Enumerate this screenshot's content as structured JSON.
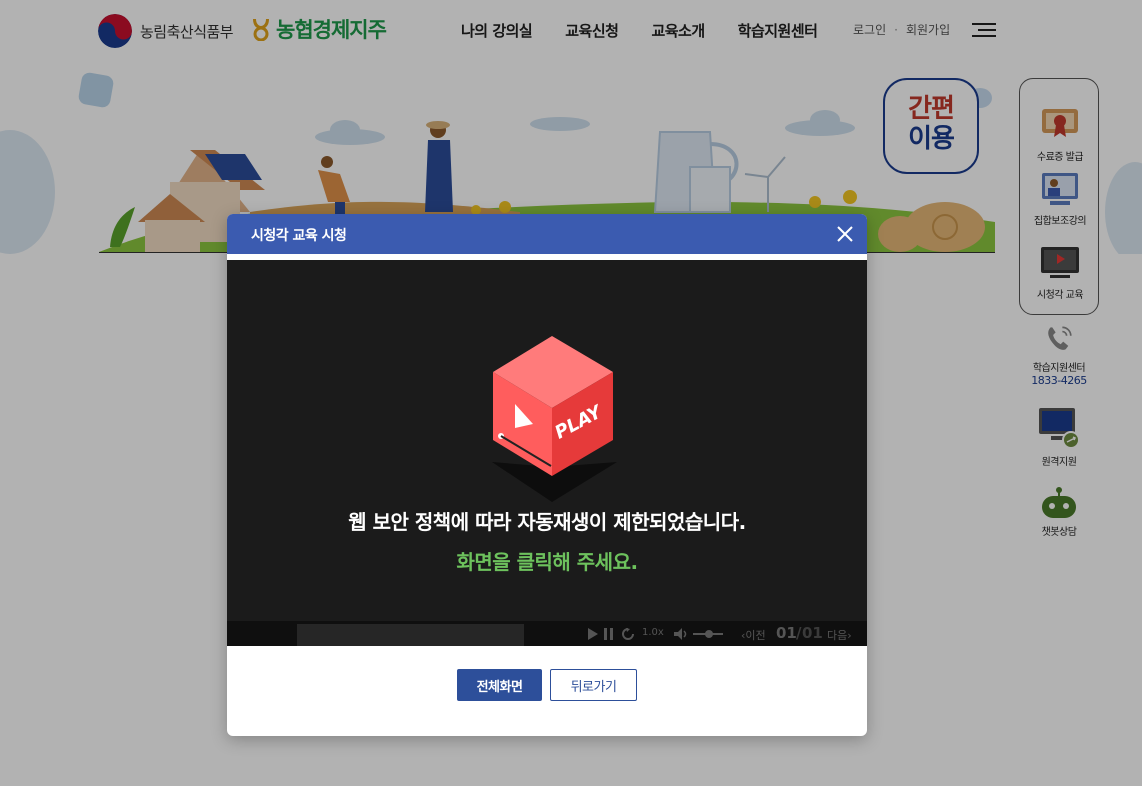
{
  "header": {
    "gov_logo_text": "농림축산식품부",
    "nh_logo_text": "농협경제지주",
    "nav": [
      "나의 강의실",
      "교육신청",
      "교육소개",
      "학습지원센터"
    ],
    "login": "로그인",
    "signup": "회원가입",
    "util_separator": "·"
  },
  "badge": {
    "line1": "간편",
    "line2": "이용"
  },
  "quick_menu": {
    "items": [
      {
        "label": "수료증 발급",
        "icon": "certificate-icon"
      },
      {
        "label": "집합보조강의",
        "icon": "video-lecture-icon"
      },
      {
        "label": "시청각 교육",
        "icon": "audiovisual-icon"
      }
    ],
    "support": {
      "label": "학습지원센터",
      "phone": "1833-4265"
    },
    "remote": {
      "label": "원격지원"
    },
    "chatbot": {
      "label": "챗봇상담"
    }
  },
  "modal": {
    "title": "시청각 교육 시청",
    "notice_line1": "웹 보안 정책에 따라 자동재생이 제한되었습니다.",
    "notice_line2": "화면을 클릭해 주세요.",
    "cube_label": "PLAY",
    "controls": {
      "speed": "1.0x",
      "prev": "‹이전",
      "current_page": "01",
      "separator": "/",
      "total_pages": "01",
      "next": "다음›"
    },
    "fullscreen_button": "전체화면",
    "back_button": "뒤로가기"
  },
  "colors": {
    "modal_header": "#3b5bb0",
    "primary_button": "#2d4f9a",
    "notice_green": "#6dc25d",
    "nh_green": "#1f9a4b",
    "badge_red": "#c0392b",
    "badge_blue": "#1a3c8f"
  }
}
